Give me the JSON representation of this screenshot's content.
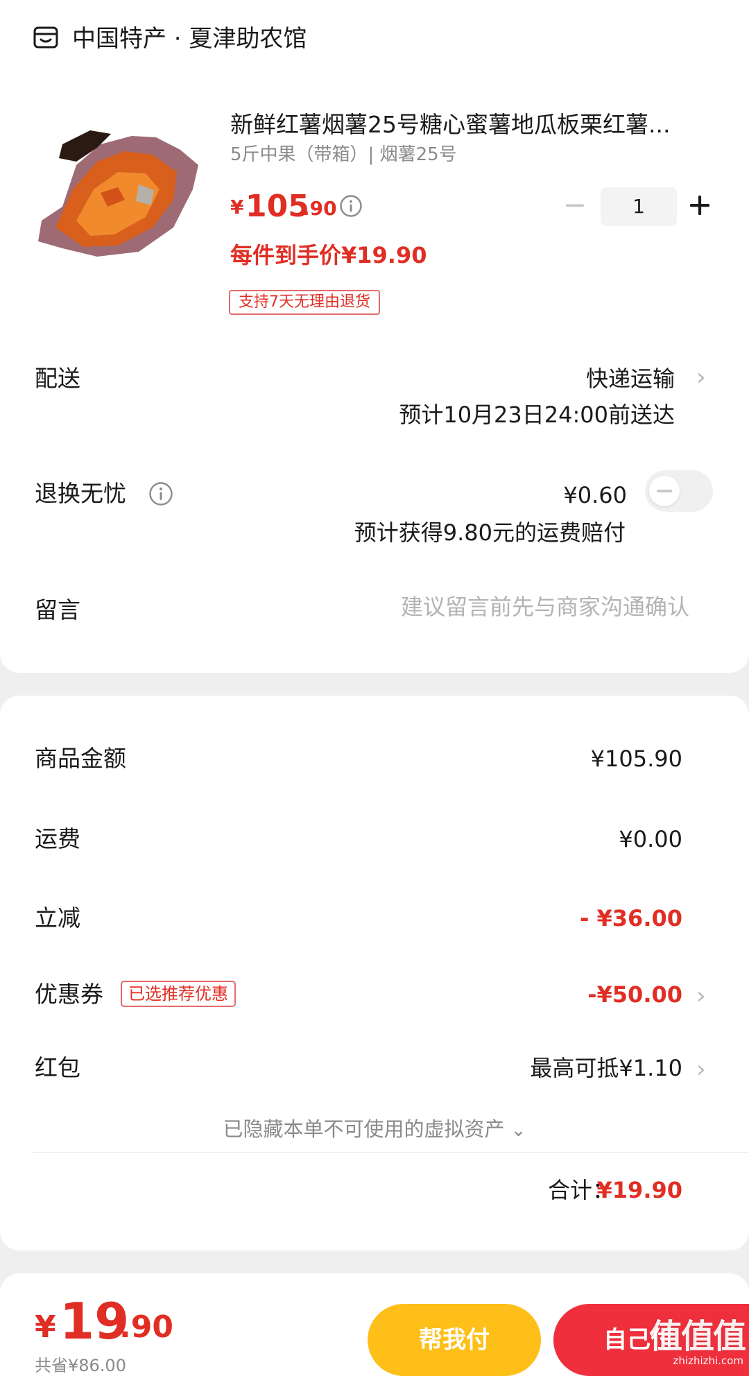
{
  "store": {
    "icon": "store-icon",
    "name": "中国特产 · 夏津助农馆"
  },
  "product": {
    "image": "roasted-sweet-potato",
    "title": "新鲜红薯烟薯25号糖心蜜薯地瓜板栗红薯...",
    "spec": "5斤中果（带箱）| 烟薯25号",
    "price_symbol": "¥",
    "price_int": "105",
    "price_dec": ".90",
    "quantity": "1",
    "per_price": "每件到手价¥19.90",
    "return_badge": "支持7天无理由退货"
  },
  "delivery": {
    "label": "配送",
    "method": "快递运输",
    "eta": "预计10月23日24:00前送达"
  },
  "insurance": {
    "label": "退换无忧",
    "price": "¥0.60",
    "description": "预计获得9.80元的运费赔付",
    "enabled": false
  },
  "note": {
    "label": "留言",
    "placeholder": "建议留言前先与商家沟通确认"
  },
  "summary": {
    "goods_label": "商品金额",
    "goods_value": "¥105.90",
    "shipping_label": "运费",
    "shipping_value": "¥0.00",
    "discount_label": "立减",
    "discount_value": "- ¥36.00",
    "coupon_label": "优惠券",
    "coupon_badge": "已选推荐优惠",
    "coupon_value": "-¥50.00",
    "redpacket_label": "红包",
    "redpacket_value": "最高可抵¥1.10",
    "hidden_assets": "已隐藏本单不可使用的虚拟资产",
    "total_label": "合计：",
    "total_value": "¥19.90"
  },
  "bottom_bar": {
    "price_symbol": "¥",
    "price_int": "19",
    "price_dec": ".90",
    "saved": "共省¥86.00",
    "help_pay_label": "帮我付",
    "self_pay_label": "自己付"
  },
  "watermark": {
    "logo": "值值值",
    "url": "zhizhizhi.com"
  },
  "colors": {
    "accent_red": "#e02e24",
    "help_button": "#ffbf19",
    "pay_button": "#ef2f3c"
  }
}
